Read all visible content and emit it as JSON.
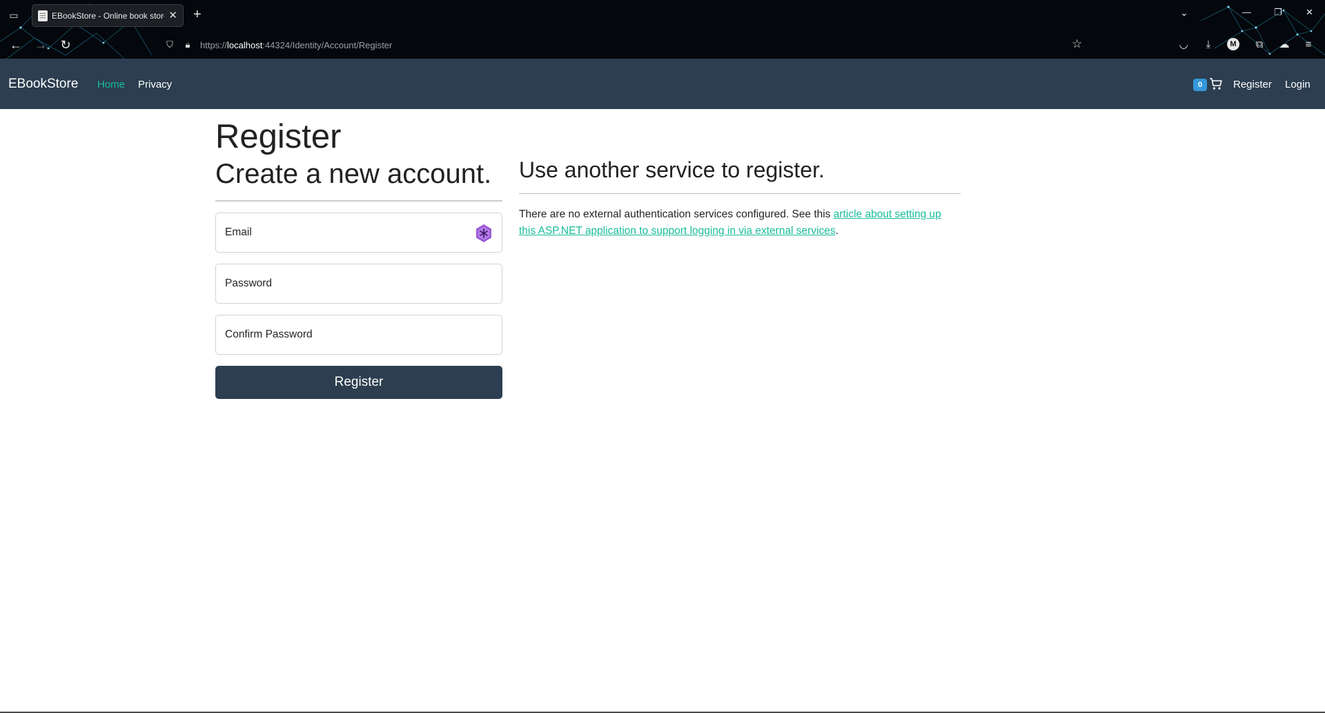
{
  "browser": {
    "tab_title": "EBookStore - Online book store",
    "new_tab_symbol": "+",
    "url_scheme": "https://",
    "url_host": "localhost",
    "url_rest": ":44324/Identity/Account/Register"
  },
  "site_nav": {
    "brand": "EBookStore",
    "home": "Home",
    "privacy": "Privacy",
    "cart_count": "0",
    "register": "Register",
    "login": "Login"
  },
  "page": {
    "title": "Register",
    "left": {
      "heading": "Create a new account.",
      "email_label": "Email",
      "password_label": "Password",
      "confirm_label": "Confirm Password",
      "submit_label": "Register"
    },
    "right": {
      "heading": "Use another service to register.",
      "text_before": "There are no external authentication services configured. See this ",
      "link_text": "article about setting up this ASP.NET application to support logging in via external services",
      "text_after": "."
    }
  },
  "colors": {
    "navbar": "#2c3e50",
    "accent": "#18bc9c",
    "badge": "#3498db",
    "chrome": "#04070c"
  }
}
